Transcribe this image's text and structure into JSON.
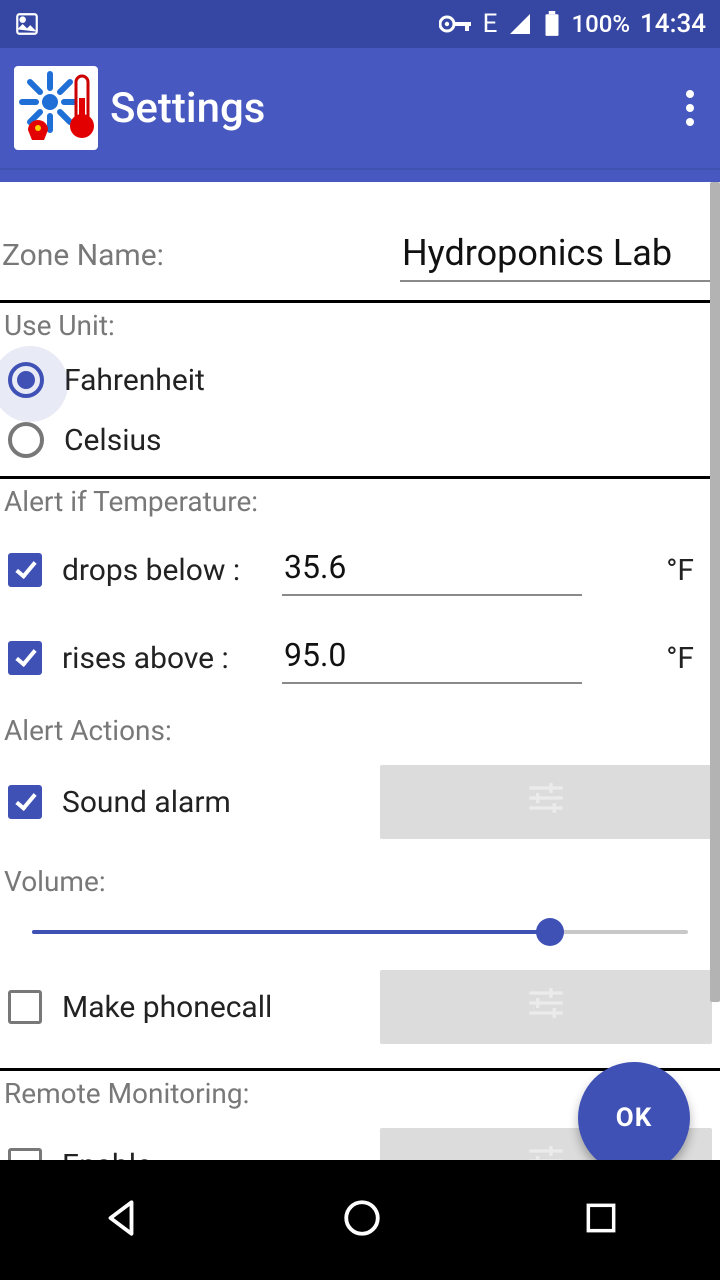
{
  "statusbar": {
    "battery_pct": "100%",
    "time": "14:34",
    "network_label": "E"
  },
  "appbar": {
    "title": "Settings"
  },
  "zone": {
    "label": "Zone Name:",
    "value": "Hydroponics Lab"
  },
  "unit": {
    "label": "Use Unit:",
    "options": {
      "fahrenheit": "Fahrenheit",
      "celsius": "Celsius"
    },
    "selected": "fahrenheit"
  },
  "alert_temp": {
    "label": "Alert if Temperature:",
    "below": {
      "enabled": true,
      "label": "drops below :",
      "value": "35.6",
      "unit": "°F"
    },
    "above": {
      "enabled": true,
      "label": "rises above :",
      "value": "95.0",
      "unit": "°F"
    }
  },
  "alert_actions": {
    "label": "Alert Actions:",
    "sound": {
      "enabled": true,
      "label": "Sound alarm"
    },
    "volume_label": "Volume:",
    "volume_pct": 79,
    "phonecall": {
      "enabled": false,
      "label": "Make phonecall"
    }
  },
  "remote": {
    "label": "Remote Monitoring:",
    "enable": {
      "enabled": false,
      "label": "Enable"
    }
  },
  "fab": {
    "label": "OK"
  }
}
